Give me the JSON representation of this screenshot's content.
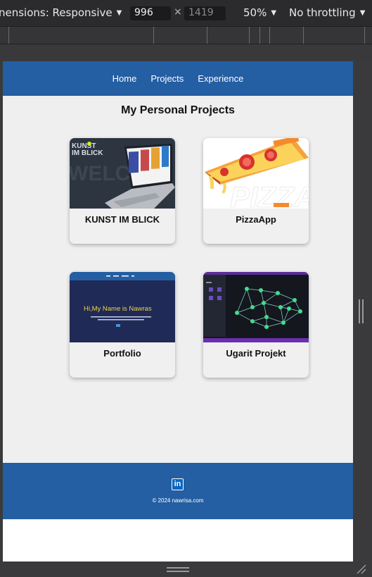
{
  "devtools": {
    "dimensions_label": "nensions: Responsive",
    "width": "996",
    "height": "1419",
    "zoom": "50%",
    "throttling": "No throttling"
  },
  "nav": {
    "items": [
      "Home",
      "Projects",
      "Experience"
    ]
  },
  "page": {
    "heading": "My Personal Projects",
    "projects": [
      {
        "title": "KUNST IM BLICK",
        "thumb_text": [
          "KUNST",
          "IM BLICK",
          "WELCO"
        ]
      },
      {
        "title": "PizzaApp",
        "thumb_text": "PIZZA"
      },
      {
        "title": "Portfolio",
        "thumb_text": "Hi,My Name is Nawras"
      },
      {
        "title": "Ugarit Projekt"
      }
    ]
  },
  "footer": {
    "social_icon": "linkedin-icon",
    "linkedin_glyph": "in",
    "copyright": "© 2024 nawrisa.com"
  },
  "colors": {
    "brand_blue": "#245ea3",
    "page_bg": "#efefef"
  }
}
